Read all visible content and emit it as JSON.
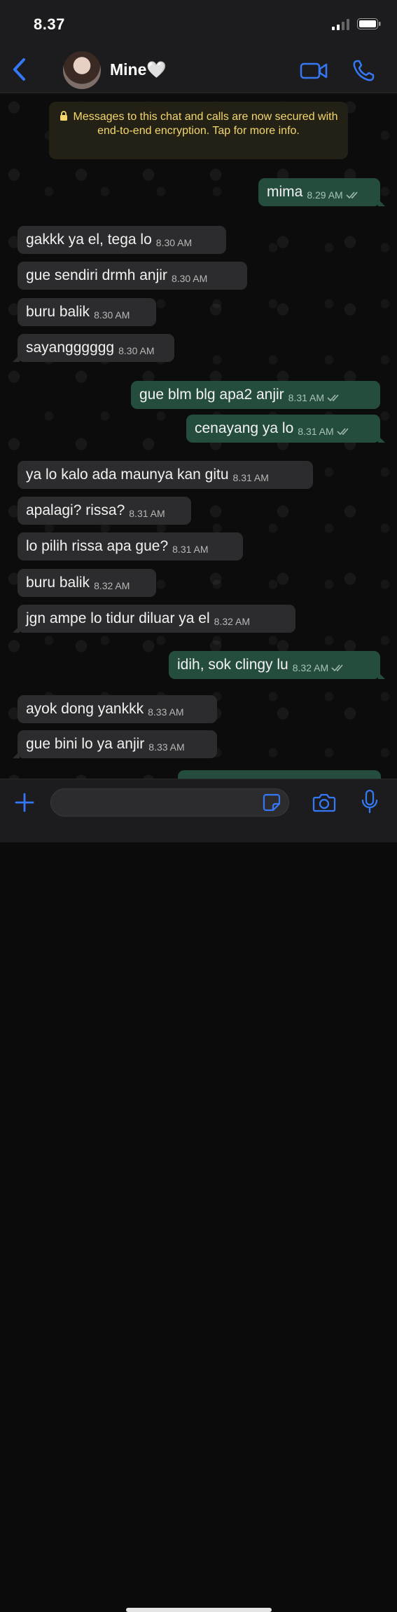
{
  "status_bar": {
    "time": "8.37"
  },
  "header": {
    "contact_name": "Mine🤍"
  },
  "notice": {
    "text": "Messages to this chat and calls are now secured with end-to-end encryption. Tap for more info."
  },
  "messages": [
    {
      "dir": "out",
      "text": "mima",
      "time": "8.29 AM"
    },
    {
      "dir": "in",
      "text": "gakkk ya el, tega lo",
      "time": "8.30 AM"
    },
    {
      "dir": "in",
      "text": "gue sendiri drmh anjir",
      "time": "8.30 AM"
    },
    {
      "dir": "in",
      "text": "buru balik",
      "time": "8.30 AM"
    },
    {
      "dir": "in",
      "text": "sayangggggg",
      "time": "8.30 AM"
    },
    {
      "dir": "out",
      "text": "gue blm blg apa2 anjir",
      "time": "8.31 AM"
    },
    {
      "dir": "out",
      "text": "cenayang ya lo",
      "time": "8.31 AM"
    },
    {
      "dir": "in",
      "text": "ya lo kalo ada maunya kan gitu",
      "time": "8.31 AM"
    },
    {
      "dir": "in",
      "text": "apalagi? rissa?",
      "time": "8.31 AM"
    },
    {
      "dir": "in",
      "text": "lo pilih rissa apa gue?",
      "time": "8.31 AM"
    },
    {
      "dir": "in",
      "text": "buru balik",
      "time": "8.32 AM"
    },
    {
      "dir": "in",
      "text": "jgn ampe lo tidur diluar ya el",
      "time": "8.32 AM"
    },
    {
      "dir": "out",
      "text": "idih, sok clingy lu",
      "time": "8.32 AM"
    },
    {
      "dir": "in",
      "text": "ayok dong yankkk",
      "time": "8.33 AM"
    },
    {
      "dir": "in",
      "text": "gue bini lo ya anjir",
      "time": "8.33 AM"
    }
  ],
  "composer": {
    "placeholder": ""
  },
  "colors": {
    "accent": "#3478f6",
    "outgoing_bubble": "#254d3e",
    "incoming_bubble": "#2c2c2e",
    "notice_text": "#f5d76e"
  }
}
